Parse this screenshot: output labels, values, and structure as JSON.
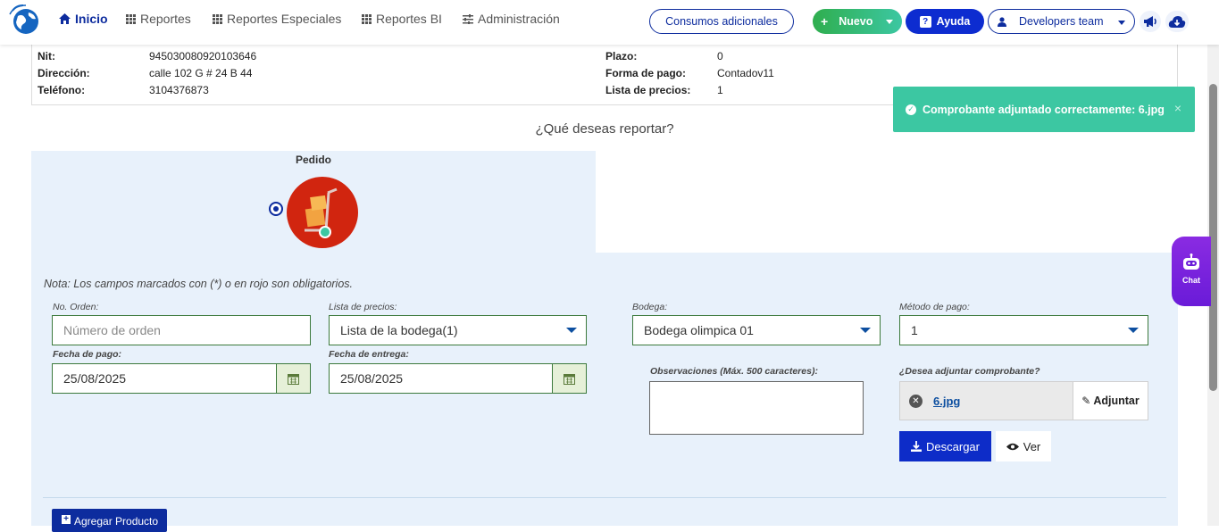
{
  "nav": {
    "items": [
      {
        "label": "Inicio",
        "icon": "home-icon"
      },
      {
        "label": "Reportes",
        "icon": "grid-icon"
      },
      {
        "label": "Reportes Especiales",
        "icon": "grid-icon"
      },
      {
        "label": "Reportes BI",
        "icon": "grid-icon"
      },
      {
        "label": "Administración",
        "icon": "sliders-icon"
      }
    ],
    "consumos_label": "Consumos adicionales",
    "nuevo_label": "Nuevo",
    "ayuda_label": "Ayuda",
    "team_label": "Developers team"
  },
  "info": {
    "nit_label": "Nit:",
    "nit_value": "945030080920103646",
    "direccion_label": "Dirección:",
    "direccion_value": "calle 102 G # 24 B 44",
    "telefono_label": "Teléfono:",
    "telefono_value": "3104376873",
    "plazo_label": "Plazo:",
    "plazo_value": "0",
    "forma_label": "Forma de pago:",
    "forma_value": "Contadov11",
    "lista_label": "Lista de precios:",
    "lista_value": "1"
  },
  "toast": {
    "message": "Comprobante adjuntado correctamente: 6.jpg",
    "close": "×"
  },
  "report": {
    "question": "¿Qué deseas reportar?",
    "option_label": "Pedido"
  },
  "form": {
    "note": "Nota: Los campos marcados con (*) o en rojo son obligatorios.",
    "orden_label": "No. Orden:",
    "orden_placeholder": "Número de orden",
    "lista_label": "Lista de precios:",
    "lista_value": "Lista de la bodega(1)",
    "bodega_label": "Bodega:",
    "bodega_value": "Bodega olimpica 01",
    "metodo_label": "Método de pago:",
    "metodo_value": "1",
    "fecha_pago_label": "Fecha de pago:",
    "fecha_pago_value": "25/08/2025",
    "fecha_entrega_label": "Fecha de entrega:",
    "fecha_entrega_value": "25/08/2025",
    "obs_label": "Observaciones (Máx. 500 caracteres):",
    "adjuntar_q": "¿Desea adjuntar comprobante?",
    "file_name": "6.jpg",
    "adjuntar_btn": "Adjuntar",
    "descargar_btn": "Descargar",
    "ver_btn": "Ver",
    "agregar_btn": "Agregar Producto"
  },
  "chat": {
    "label": "Chat"
  },
  "colors": {
    "primary": "#0d2c9e",
    "green": "#3cc7a2",
    "panel": "#e8f1fb",
    "purple": "#8a2be2"
  }
}
